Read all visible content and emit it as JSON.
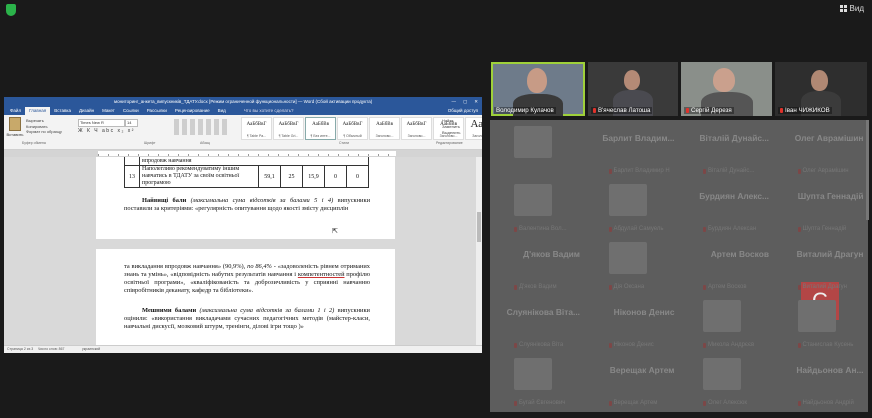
{
  "topbar": {
    "view_label": "Вид"
  },
  "word": {
    "title": "мониторинг_анкета_випускників_ТДАТУ.docx [Режим ограниченной функциональности] — Word (Сбой активации продукта)",
    "tabs": [
      "Файл",
      "Главная",
      "Вставка",
      "Дизайн",
      "Макет",
      "Ссылки",
      "Рассылки",
      "Рецензирование",
      "Вид"
    ],
    "active_tab": "Главная",
    "tell_me": "Что вы хотите сделать?",
    "share": "Общий доступ",
    "paste_label": "Вставить",
    "clip_cmds": [
      "Вырезать",
      "Копировать",
      "Формат по образцу"
    ],
    "font_name": "Times New R",
    "font_size": "14",
    "format_row": "Ж К Ч abc x₂ x²",
    "styles": [
      {
        "sample": "АаБбВвГ",
        "name": "¶ Table Pa..."
      },
      {
        "sample": "АаБбВвГ",
        "name": "¶ Table Gri..."
      },
      {
        "sample": "АаБбВв",
        "name": "¶ Без инте..."
      },
      {
        "sample": "АаБбВвГ",
        "name": "¶ Обычный"
      },
      {
        "sample": "АаБбВв",
        "name": "Заголово..."
      },
      {
        "sample": "АаБбВвГ",
        "name": "Заголово..."
      },
      {
        "sample": "АаБбВв",
        "name": "Заголово..."
      },
      {
        "sample": "АаВ",
        "name": "Заголовок"
      }
    ],
    "edit_cmds": [
      "Найти",
      "Заменить",
      "Выделить"
    ],
    "group_labels": {
      "clipboard": "Буфер обмена",
      "font": "Шрифт",
      "paragraph": "Абзац",
      "styles": "Стили",
      "editing": "Редактирование"
    },
    "table": {
      "row_top": "впродовж навчання",
      "row_num": "13",
      "row_text": "Наполегливо рекомендуватиму іншим навчатись в ТДАТУ за своїм освітньої програмою",
      "cells": [
        "59,1",
        "25",
        "15,9",
        "0",
        "0"
      ]
    },
    "p1_bold": "Найвищі бали",
    "p1_ital": "(максимальна сума відсотків за балами 5 і 4)",
    "p1_rest": "випускники поставили за критеріями: «регулярність опитування щодо якості змісту дисциплін",
    "p2_a": "та викладання впродовж навчання» (90,9%), ",
    "p2_b": "по 86,4%",
    "p2_c": " - «задоволеність рівнем отриманих знань та умінь», «відповідність набутих результатів навчання і ",
    "p2_u": "компетентностей",
    "p2_d": " профілю освітньої програми», «кваліфікованість та доброзичливість у сприянні навчанню співробітників деканату, кафедр та бібліотеки».",
    "p3_bold": "Мешними балами",
    "p3_ital": "(максимальна сума відсотків за балами 1 і 2)",
    "p3_rest": "випускники оцінили: «використання викладачами сучасних педагогічних методів (майстер-класи, навчальні дискусії, мозковий штурм, тренінги, ділові ігри тощо )»",
    "status": {
      "page": "Страница 2 из 3",
      "words": "Число слов: 867",
      "lang": "украинский"
    }
  },
  "video_tiles": [
    {
      "name": "Володимир Кулачов",
      "muted": false
    },
    {
      "name": "В'ячеслав Латоша",
      "muted": true
    },
    {
      "name": "Сергій Дерезя",
      "muted": true
    },
    {
      "name": "Іван ЧИЖИКОВ",
      "muted": true
    }
  ],
  "gallery": [
    {
      "name": "",
      "sub": ""
    },
    {
      "name": "Барлит Владим...",
      "sub": "Барлит Владимир Н"
    },
    {
      "name": "Віталій Дунайс...",
      "sub": "Віталій Дунайс..."
    },
    {
      "name": "Олег Аврамішин",
      "sub": "Олег Аврамішин"
    },
    {
      "name": "",
      "sub": "Валентина Вол..."
    },
    {
      "name": "",
      "sub": "Абдулай Самуель"
    },
    {
      "name": "Бурдиян Алекс...",
      "sub": "Бурдиян Алексан"
    },
    {
      "name": "Шупта Геннадій",
      "sub": "Шупта Геннадій"
    },
    {
      "name": "Д'яков Вадим",
      "sub": "Д'яков Вадим"
    },
    {
      "name": "",
      "sub": "Дія Оксана"
    },
    {
      "name": "Артем Восков",
      "sub": "Артем Восков"
    },
    {
      "name": "Виталий Драгун",
      "sub": "Виталий Драгун"
    },
    {
      "name": "Слуянікова Віта...",
      "sub": "Слуянікова Віта"
    },
    {
      "name": "Ніконов Денис",
      "sub": "Ніконов Денис"
    },
    {
      "name": "",
      "sub": "Микола Андрєєв"
    },
    {
      "name": "",
      "sub": "Станислав Кусень"
    },
    {
      "name": "",
      "sub": "Бугай Євгенович"
    },
    {
      "name": "Верещак Артем",
      "sub": "Верещак Артем"
    },
    {
      "name": "",
      "sub": "Олег Алексюк"
    },
    {
      "name": "Найдьонов Ан...",
      "sub": "Найдьонов Андрій"
    }
  ],
  "avatar_letter": "С"
}
